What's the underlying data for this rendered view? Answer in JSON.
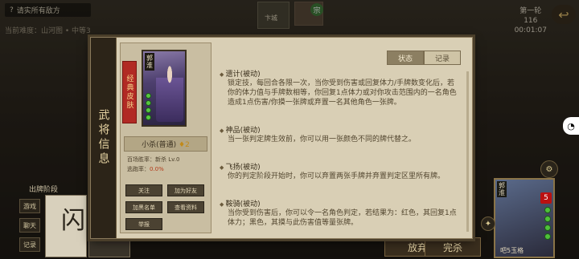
{
  "topbar": {
    "help_text": "请实所有敌方",
    "progress_text": "当前难度：山河图 • 中等3",
    "round_label": "第一轮",
    "score_text": "116",
    "timer": "00:01:07",
    "top_card_label": "卞城",
    "green_badge": "宗"
  },
  "dialog": {
    "side_title": "武将信息",
    "ribbon_text": "经典皮肤",
    "portrait_name": "郭淮",
    "general_name": "小杀(普通)",
    "general_tag": "♦2",
    "stat_line1": "百场胜率：新杀    Lv.0",
    "stat_line2_label": "逃跑率：",
    "stat_line2_value": "0.0%",
    "actions": [
      "关注",
      "加为好友",
      "加黑名单",
      "查看资料",
      "举报"
    ],
    "tabs": {
      "status": "状态",
      "records": "记录"
    },
    "skills": [
      {
        "title": "遗计(被动)",
        "desc": "锁定技，每回合各限一次，当你受到伤害或回复体力/手牌数变化后，若你的体力值与手牌数相等，你回复1点体力或对你攻击范围内的一名角色造成1点伤害/你摸一张牌或弃置一名其他角色一张牌。"
      },
      {
        "title": "神品(被动)",
        "desc": "当一张判定牌生效前，你可以用一张颜色不同的牌代替之。"
      },
      {
        "title": "飞扬(被动)",
        "desc": "你的判定阶段开始时，你可以弃置两张手牌并弃置判定区里所有牌。"
      },
      {
        "title": "鞍骑(被动)",
        "desc": "当你受到伤害后，你可以令一名角色判定，若结果为：红色，其回复1点体力；黑色，其摸与此伤害值等量张牌。"
      }
    ]
  },
  "bottom": {
    "phase_label": "出牌阶段",
    "left_buttons": [
      "游戏",
      "聊天",
      "记录"
    ],
    "hand_glyph": "闪",
    "abandon": "放弃",
    "confirm": "完杀",
    "right_player_name": "郭淮",
    "right_player_cards": "5",
    "right_status": "吧5玉格"
  }
}
